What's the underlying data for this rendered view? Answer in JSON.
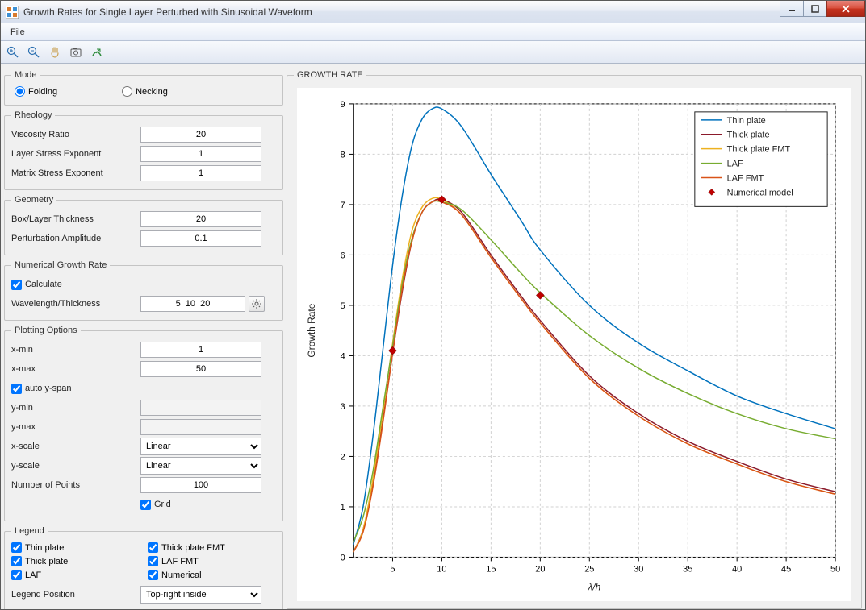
{
  "window": {
    "title": "Growth Rates for Single Layer Perturbed with Sinusoidal Waveform"
  },
  "menu": {
    "file": "File"
  },
  "mode": {
    "legend": "Mode",
    "folding": "Folding",
    "necking": "Necking",
    "selected": "folding"
  },
  "rheology": {
    "legend": "Rheology",
    "viscosity_ratio_label": "Viscosity Ratio",
    "viscosity_ratio": "20",
    "layer_stress_exp_label": "Layer Stress Exponent",
    "layer_stress_exp": "1",
    "matrix_stress_exp_label": "Matrix Stress Exponent",
    "matrix_stress_exp": "1"
  },
  "geometry": {
    "legend": "Geometry",
    "box_layer_label": "Box/Layer Thickness",
    "box_layer": "20",
    "pert_amp_label": "Perturbation Amplitude",
    "pert_amp": "0.1"
  },
  "numgr": {
    "legend": "Numerical Growth Rate",
    "calculate": "Calculate",
    "wl_th_label": "Wavelength/Thickness",
    "wl_th": "5  10  20"
  },
  "plotopts": {
    "legend": "Plotting Options",
    "xmin_label": "x-min",
    "xmin": "1",
    "xmax_label": "x-max",
    "xmax": "50",
    "auto_yspan": "auto y-span",
    "ymin_label": "y-min",
    "ymin": "",
    "ymax_label": "y-max",
    "ymax": "",
    "xscale_label": "x-scale",
    "xscale": "Linear",
    "yscale_label": "y-scale",
    "yscale": "Linear",
    "npoints_label": "Number of Points",
    "npoints": "100",
    "grid": "Grid"
  },
  "legend_panel": {
    "legend": "Legend",
    "thin": "Thin plate",
    "thick": "Thick plate",
    "laf": "LAF",
    "thick_fmt": "Thick plate FMT",
    "laf_fmt": "LAF FMT",
    "numerical": "Numerical",
    "pos_label": "Legend Position",
    "pos": "Top-right inside"
  },
  "chart_fieldset": "GROWTH RATE",
  "chart_data": {
    "type": "line",
    "xlabel": "λ/h",
    "ylabel": "Growth Rate",
    "xlim": [
      1,
      50
    ],
    "ylim": [
      0,
      9
    ],
    "xticks": [
      5,
      10,
      15,
      20,
      25,
      30,
      35,
      40,
      45,
      50
    ],
    "yticks": [
      0,
      1,
      2,
      3,
      4,
      5,
      6,
      7,
      8,
      9
    ],
    "grid": true,
    "legend_position": "top-right",
    "series": [
      {
        "name": "Thin plate",
        "color": "#0072bd",
        "x": [
          1,
          2,
          3,
          4,
          5,
          6,
          7,
          8,
          9,
          10,
          12,
          15,
          18,
          20,
          25,
          30,
          35,
          40,
          45,
          50
        ],
        "y": [
          0.25,
          1.0,
          2.4,
          4.1,
          5.8,
          7.2,
          8.2,
          8.7,
          8.9,
          8.9,
          8.55,
          7.6,
          6.7,
          6.1,
          5.0,
          4.25,
          3.7,
          3.2,
          2.85,
          2.55
        ]
      },
      {
        "name": "Thick plate",
        "color": "#8b1a2b",
        "x": [
          1,
          2,
          3,
          4,
          5,
          6,
          7,
          8,
          9,
          10,
          12,
          15,
          18,
          20,
          25,
          30,
          35,
          40,
          45,
          50
        ],
        "y": [
          0.1,
          0.55,
          1.45,
          2.7,
          4.05,
          5.3,
          6.3,
          6.85,
          7.05,
          7.1,
          6.85,
          6.0,
          5.2,
          4.7,
          3.6,
          2.85,
          2.3,
          1.9,
          1.55,
          1.3
        ]
      },
      {
        "name": "Thick plate FMT",
        "color": "#edb120",
        "x": [
          1,
          2,
          3,
          4,
          5,
          6,
          7,
          8,
          9,
          10,
          12,
          15,
          18,
          20,
          25,
          30,
          35,
          40,
          45,
          50
        ],
        "y": [
          0.1,
          0.55,
          1.55,
          2.85,
          4.25,
          5.55,
          6.5,
          6.95,
          7.12,
          7.1,
          6.8,
          5.95,
          5.15,
          4.65,
          3.55,
          2.8,
          2.25,
          1.85,
          1.5,
          1.25
        ]
      },
      {
        "name": "LAF",
        "color": "#77ac30",
        "x": [
          1,
          2,
          3,
          4,
          5,
          6,
          7,
          8,
          9,
          10,
          12,
          15,
          18,
          20,
          25,
          30,
          35,
          40,
          45,
          50
        ],
        "y": [
          0.3,
          0.8,
          1.7,
          2.95,
          4.2,
          5.45,
          6.35,
          6.85,
          7.05,
          7.05,
          6.9,
          6.3,
          5.65,
          5.25,
          4.4,
          3.75,
          3.25,
          2.85,
          2.55,
          2.35
        ]
      },
      {
        "name": "LAF FMT",
        "color": "#d95319",
        "x": [
          1,
          2,
          3,
          4,
          5,
          6,
          7,
          8,
          9,
          10,
          12,
          15,
          18,
          20,
          25,
          30,
          35,
          40,
          45,
          50
        ],
        "y": [
          0.1,
          0.5,
          1.4,
          2.65,
          4.05,
          5.35,
          6.3,
          6.85,
          7.05,
          7.05,
          6.8,
          5.95,
          5.15,
          4.65,
          3.55,
          2.8,
          2.25,
          1.85,
          1.5,
          1.25
        ]
      }
    ],
    "markers": {
      "name": "Numerical model",
      "symbol": "diamond",
      "color": "#c00000",
      "x": [
        5,
        10,
        20
      ],
      "y": [
        4.1,
        7.1,
        5.2
      ]
    }
  }
}
